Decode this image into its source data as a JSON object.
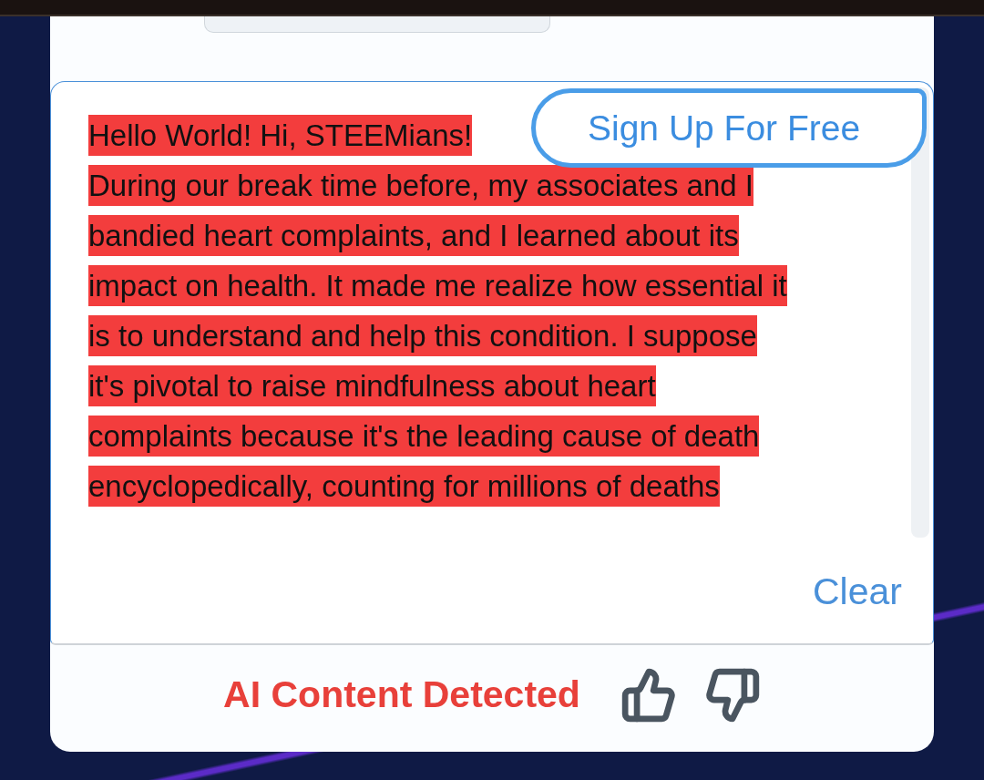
{
  "editor": {
    "lines": [
      "Hello World! Hi, STEEMians!",
      "During our break time before, my associates and I",
      "bandied heart complaints, and I learned about its",
      "impact on health. It made me realize how essential it",
      "is to understand and help this condition. I suppose",
      "it's pivotal to raise mindfulness about heart",
      "complaints because it's the leading cause of death",
      "encyclopedically, counting for millions of deaths"
    ],
    "sign_up_button": "Sign Up For Free",
    "clear_button": "Clear"
  },
  "result": {
    "label": "AI Content Detected"
  }
}
